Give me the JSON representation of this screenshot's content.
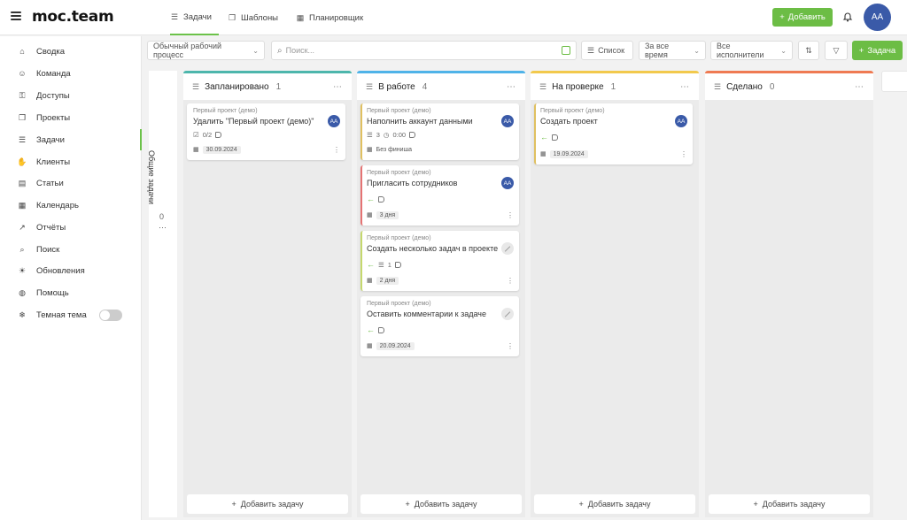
{
  "app": {
    "logo": "moc.team"
  },
  "top_tabs": [
    {
      "label": "Задачи",
      "icon": "list-check-icon",
      "active": true
    },
    {
      "label": "Шаблоны",
      "icon": "copy-icon",
      "active": false
    },
    {
      "label": "Планировщик",
      "icon": "calendar-icon",
      "active": false
    }
  ],
  "header": {
    "add_label": "Добавить",
    "user_initials": "AA"
  },
  "sidebar": {
    "items": [
      {
        "label": "Сводка",
        "icon": "home-icon"
      },
      {
        "label": "Команда",
        "icon": "team-icon"
      },
      {
        "label": "Доступы",
        "icon": "key-icon"
      },
      {
        "label": "Проекты",
        "icon": "folders-icon"
      },
      {
        "label": "Задачи",
        "icon": "tasks-icon",
        "active": true
      },
      {
        "label": "Клиенты",
        "icon": "handshake-icon"
      },
      {
        "label": "Статьи",
        "icon": "article-icon"
      },
      {
        "label": "Календарь",
        "icon": "calendar-icon"
      },
      {
        "label": "Отчёты",
        "icon": "chart-icon"
      },
      {
        "label": "Поиск",
        "icon": "search-icon"
      },
      {
        "label": "Обновления",
        "icon": "bulb-icon"
      },
      {
        "label": "Помощь",
        "icon": "globe-icon"
      },
      {
        "label": "Темная тема",
        "icon": "snowflake-icon"
      }
    ]
  },
  "toolbar": {
    "workflow": "Обычный рабочий процесс",
    "search_placeholder": "Поиск...",
    "view_label": "Список",
    "period": "За все время",
    "assignees": "Все исполнители",
    "task_button": "Задача"
  },
  "collapsed_column": {
    "label": "Общие задачи",
    "count": "0"
  },
  "columns": [
    {
      "title": "Запланировано",
      "count": "1",
      "color": "#4db6ac",
      "add_label": "Добавить задачу",
      "cards": [
        {
          "project": "Первый проект (демо)",
          "title": "Удалить \"Первый проект (демо)\"",
          "avatar": "AA",
          "checklist": "0/2",
          "date": "30.09.2024"
        }
      ]
    },
    {
      "title": "В работе",
      "count": "4",
      "color": "#4fb3e8",
      "add_label": "Добавить задачу",
      "cards": [
        {
          "project": "Первый проект (демо)",
          "title": "Наполнить аккаунт данными",
          "avatar": "AA",
          "subtasks": "3",
          "time": "0:00",
          "date": "Без финиша",
          "border": "#e0c060"
        },
        {
          "project": "Первый проект (демо)",
          "title": "Пригласить сотрудников",
          "avatar": "AA",
          "date": "3 дня",
          "border": "#e57373"
        },
        {
          "project": "Первый проект (демо)",
          "title": "Создать несколько задач в проекте",
          "subtasks": "1",
          "date": "2 дня",
          "border": "#c5d86d"
        },
        {
          "project": "Первый проект (демо)",
          "title": "Оставить комментарии к задаче",
          "date": "20.09.2024"
        }
      ]
    },
    {
      "title": "На проверке",
      "count": "1",
      "color": "#f2c94c",
      "add_label": "Добавить задачу",
      "cards": [
        {
          "project": "Первый проект (демо)",
          "title": "Создать проект",
          "avatar": "AA",
          "date": "19.09.2024",
          "border": "#e0c060"
        }
      ]
    },
    {
      "title": "Сделано",
      "count": "0",
      "color": "#ef7a52",
      "add_label": "Добавить задачу",
      "cards": []
    }
  ]
}
